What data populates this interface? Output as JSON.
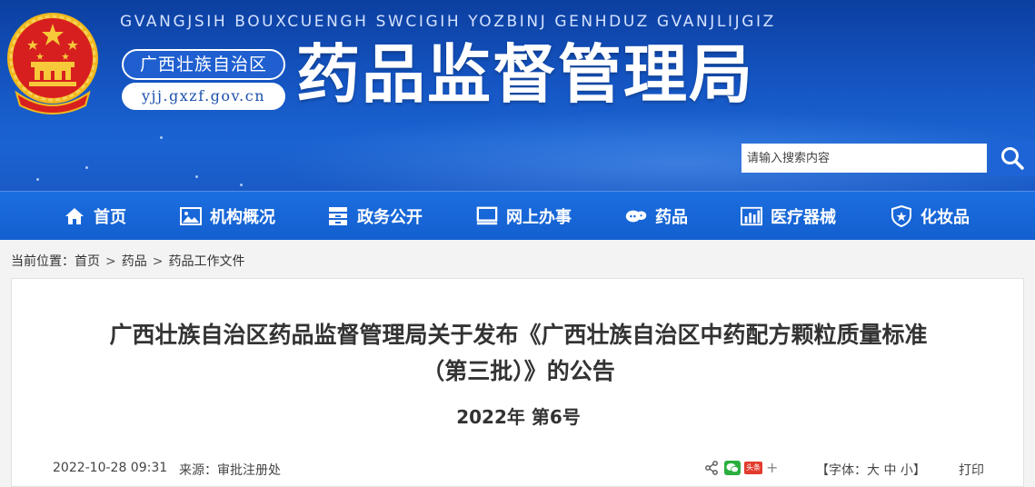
{
  "header": {
    "pinyin": "GVANGJSIH BOUXCUENGH SWCIGIH YOZBINJ GENHDUZ GVANJLIJGIZ",
    "region": "广西壮族自治区",
    "url": "yjj.gxzf.gov.cn",
    "title": "药品监督管理局",
    "search_placeholder": "请输入搜索内容"
  },
  "nav": [
    {
      "label": "首页",
      "icon": "home-icon"
    },
    {
      "label": "机构概况",
      "icon": "image-icon"
    },
    {
      "label": "政务公开",
      "icon": "archive-icon"
    },
    {
      "label": "网上办事",
      "icon": "monitor-icon"
    },
    {
      "label": "药品",
      "icon": "pill-icon"
    },
    {
      "label": "医疗器械",
      "icon": "bar-chart-icon"
    },
    {
      "label": "化妆品",
      "icon": "shield-icon"
    }
  ],
  "breadcrumb": {
    "prefix": "当前位置：",
    "items": [
      "首页",
      "药品",
      "药品工作文件"
    ],
    "separator": ">"
  },
  "article": {
    "title_line1": "广西壮族自治区药品监督管理局关于发布《广西壮族自治区中药配方颗粒质量标准",
    "title_line2": "（第三批）》的公告",
    "doc_number": "2022年 第6号",
    "date": "2022-10-28 09:31",
    "source_label": "来源：",
    "source": "审批注册处",
    "font_label": "【字体：",
    "font_large": "大",
    "font_medium": "中",
    "font_small": "小",
    "font_close": "】",
    "print": "打印",
    "weibo_badge": "头条",
    "plus": "+"
  },
  "colors": {
    "header_blue": "#1556c4",
    "nav_blue": "#1a6ade",
    "emblem_red": "#d71f1f",
    "emblem_gold": "#f0b81c"
  }
}
